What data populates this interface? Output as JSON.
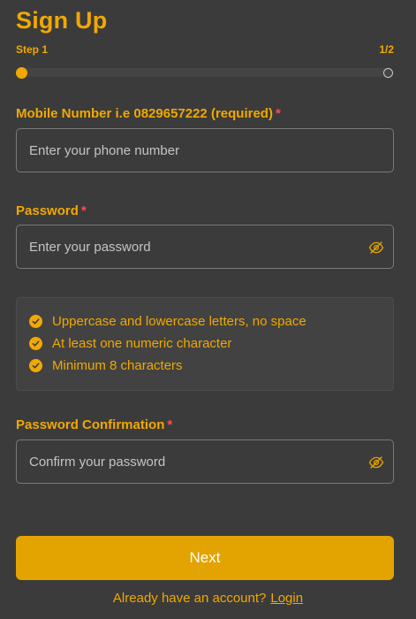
{
  "header": {
    "title": "Sign Up"
  },
  "stepper": {
    "step_label": "Step 1",
    "step_count": "1/2",
    "progress": 0.0
  },
  "fields": {
    "mobile": {
      "label": "Mobile Number i.e 0829657222 (required)",
      "required_mark": "*",
      "placeholder": "Enter your phone number",
      "value": ""
    },
    "password": {
      "label": "Password",
      "required_mark": "*",
      "placeholder": "Enter your password",
      "value": "",
      "toggle_icon": "eye-off-icon"
    },
    "password_confirmation": {
      "label": "Password Confirmation",
      "required_mark": "*",
      "placeholder": "Confirm your password",
      "value": "",
      "toggle_icon": "eye-off-icon"
    }
  },
  "password_rules": [
    {
      "text": "Uppercase and lowercase letters, no space",
      "met": true
    },
    {
      "text": "At least one numeric character",
      "met": true
    },
    {
      "text": "Minimum 8 characters",
      "met": true
    }
  ],
  "actions": {
    "next_label": "Next"
  },
  "footer": {
    "prompt": "Already have an account?",
    "login_link": "Login"
  },
  "colors": {
    "accent": "#f1a800",
    "button": "#e3a300",
    "background": "#3b3b3b",
    "required": "#ff4d4d"
  }
}
